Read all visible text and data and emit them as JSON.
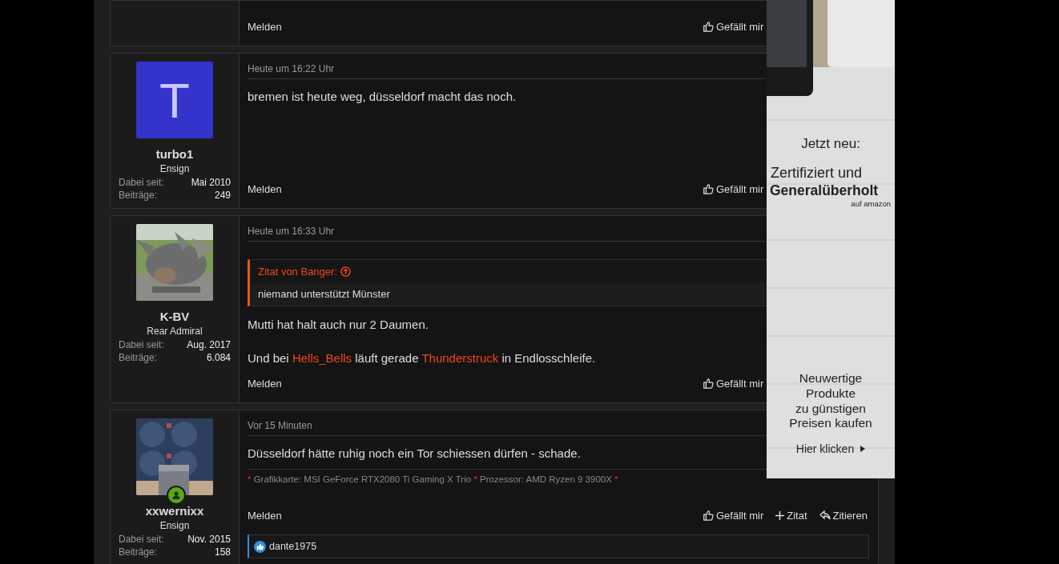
{
  "posts": [
    {
      "report": "Melden",
      "actions": [
        {
          "kind": "like",
          "label": "Gefällt mir"
        }
      ]
    },
    {
      "avatar": {
        "kind": "letter",
        "letter": "T",
        "color": "#3434cc"
      },
      "name": "turbo1",
      "rank": "Ensign",
      "stats": [
        {
          "label": "Dabei seit:",
          "value": "Mai 2010"
        },
        {
          "label": "Beiträge:",
          "value": "249"
        }
      ],
      "date": "Heute um 16:22 Uhr",
      "paragraphs": [
        [
          {
            "kind": "text",
            "text": "bremen ist heute weg, düsseldorf macht das noch."
          }
        ]
      ],
      "report": "Melden",
      "actions": [
        {
          "kind": "like",
          "label": "Gefällt mir"
        }
      ]
    },
    {
      "avatar": {
        "kind": "picture"
      },
      "name": "K-BV",
      "rank": "Rear Admiral",
      "stats": [
        {
          "label": "Dabei seit:",
          "value": "Aug. 2017"
        },
        {
          "label": "Beiträge:",
          "value": "6.084"
        }
      ],
      "date": "Heute um 16:33 Uhr",
      "quote": {
        "title": "Zitat von Banger:",
        "text": "niemand unterstützt Münster"
      },
      "paragraphs": [
        [
          {
            "kind": "text",
            "text": "Mutti hat halt auch nur 2 Daumen."
          }
        ],
        [
          {
            "kind": "text",
            "text": "Und bei "
          },
          {
            "kind": "link",
            "text": "Hells_Bells"
          },
          {
            "kind": "text",
            "text": " läuft gerade "
          },
          {
            "kind": "link",
            "text": "Thunderstruck"
          },
          {
            "kind": "text",
            "text": " in Endlosschleife."
          }
        ]
      ],
      "report": "Melden",
      "actions": [
        {
          "kind": "like",
          "label": "Gefällt mir"
        }
      ]
    },
    {
      "avatar": {
        "kind": "picture"
      },
      "online": true,
      "name": "xxwernixx",
      "rank": "Ensign",
      "stats": [
        {
          "label": "Dabei seit:",
          "value": "Nov. 2015"
        },
        {
          "label": "Beiträge:",
          "value": "158"
        }
      ],
      "date": "Vor 15 Minuten",
      "paragraphs": [
        [
          {
            "kind": "text",
            "text": "Düsseldorf hätte ruhig noch ein Tor schiessen dürfen - schade."
          }
        ]
      ],
      "signature": [
        {
          "kind": "mark",
          "text": "*"
        },
        {
          "kind": "text",
          "text": " Grafikkarte: MSI GeForce RTX2080 Ti Gaming X Trio "
        },
        {
          "kind": "mark",
          "text": "*"
        },
        {
          "kind": "text",
          "text": " Prozessor: AMD Ryzen 9 3900X "
        },
        {
          "kind": "mark",
          "text": "*"
        }
      ],
      "report": "Melden",
      "actions": [
        {
          "kind": "like",
          "label": "Gefällt mir"
        },
        {
          "kind": "add",
          "label": "Zitat"
        },
        {
          "kind": "reply",
          "label": "Zitieren"
        }
      ],
      "reactions": [
        {
          "user": "dante1975"
        }
      ]
    }
  ],
  "ad": {
    "headline": "Jetzt neu:",
    "title": "Zertifiziert und",
    "title_bold": "Generalüberholt",
    "source": "auf amazon",
    "lines": [
      "Neuwertige",
      "Produkte",
      "zu günstigen",
      "Preisen kaufen"
    ],
    "cta": "Hier klicken"
  }
}
